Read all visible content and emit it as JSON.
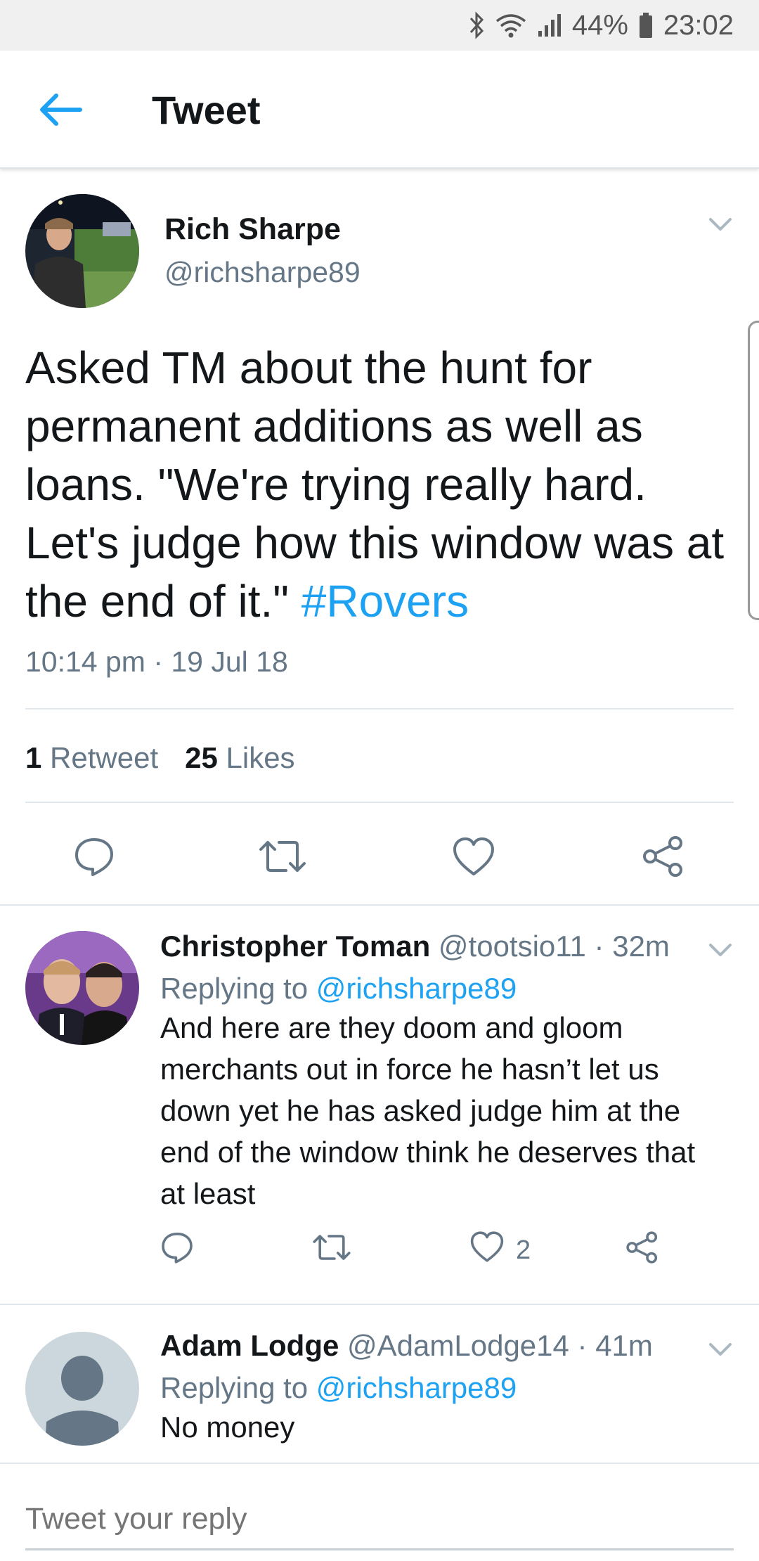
{
  "status_bar": {
    "battery_percent": "44%",
    "time": "23:02",
    "icons": [
      "bluetooth-icon",
      "wifi-icon",
      "signal-icon",
      "battery-icon"
    ]
  },
  "header": {
    "title": "Tweet",
    "back_icon": "back-arrow-icon"
  },
  "main_tweet": {
    "author_name": "Rich Sharpe",
    "author_handle": "@richsharpe89",
    "text": "Asked TM about the hunt for permanent additions as well as loans. \"We're trying really hard. Let's judge how this window was at the end of it.\" ",
    "hashtag": "#Rovers",
    "timestamp": "10:14 pm · 19 Jul 18",
    "retweet_count": "1",
    "retweet_label": "Retweet",
    "like_count": "25",
    "like_label": "Likes",
    "actions": [
      "reply-icon",
      "retweet-icon",
      "like-icon",
      "share-icon"
    ]
  },
  "replies": [
    {
      "name": "Christopher Toman",
      "handle_time": " @tootsio11 · 32m",
      "replying_prefix": "Replying to ",
      "replying_to": "@richsharpe89",
      "text": "And here are they doom and gloom merchants out in force he hasn’t let us down yet he has asked judge him at the end of the window think he deserves that at least",
      "like_count": "2"
    },
    {
      "name": "Adam Lodge",
      "handle_time": " @AdamLodge14 · 41m",
      "replying_prefix": "Replying to ",
      "replying_to": "@richsharpe89",
      "text": "No money"
    }
  ],
  "compose": {
    "placeholder": "Tweet your reply"
  },
  "colors": {
    "accent": "#1da1f2",
    "secondary_text": "#657786",
    "primary_text": "#14171a",
    "divider": "#e1e8ed"
  }
}
